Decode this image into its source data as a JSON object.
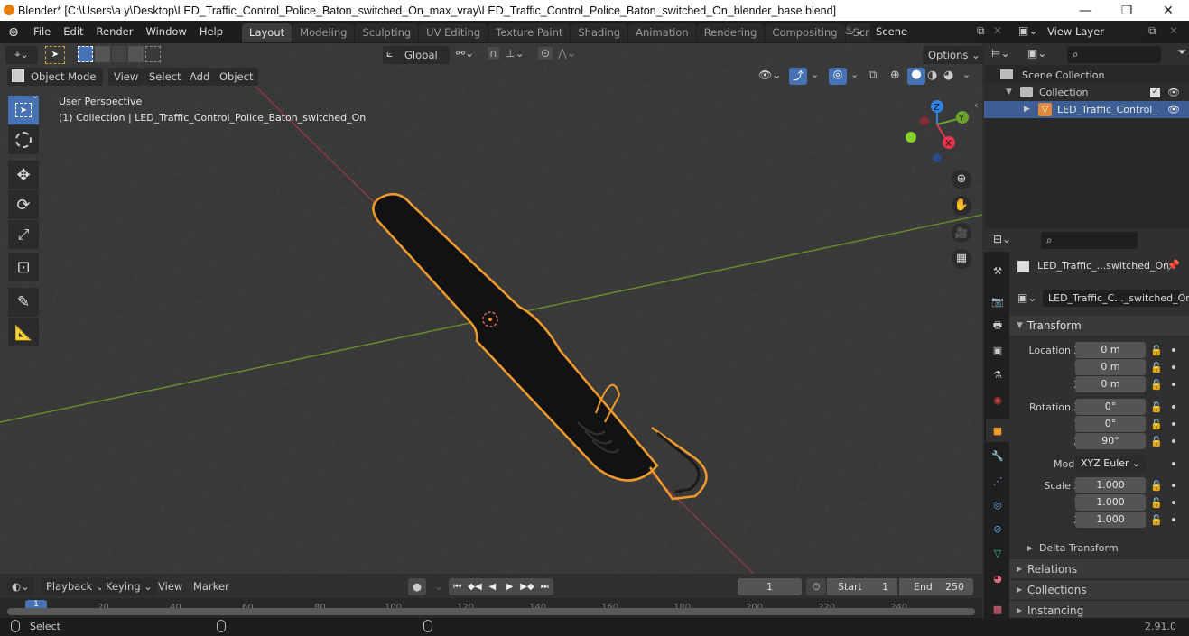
{
  "window": {
    "title": "Blender* [C:\\Users\\a y\\Desktop\\LED_Traffic_Control_Police_Baton_switched_On_max_vray\\LED_Traffic_Control_Police_Baton_switched_On_blender_base.blend]",
    "minimize": "—",
    "maximize": "❐",
    "close": "✕"
  },
  "menu": [
    "File",
    "Edit",
    "Render",
    "Window",
    "Help"
  ],
  "workspaces": [
    {
      "label": "Layout",
      "active": true
    },
    {
      "label": "Modeling"
    },
    {
      "label": "Sculpting"
    },
    {
      "label": "UV Editing"
    },
    {
      "label": "Texture Paint"
    },
    {
      "label": "Shading"
    },
    {
      "label": "Animation"
    },
    {
      "label": "Rendering"
    },
    {
      "label": "Compositing"
    },
    {
      "label": "Scripting"
    }
  ],
  "add_workspace": "+",
  "scene": {
    "value": "Scene"
  },
  "view_layer": {
    "value": "View Layer"
  },
  "toolbar": {
    "orientation": "Global",
    "options": "Options"
  },
  "header": {
    "mode": "Object Mode",
    "view": "View",
    "select": "Select",
    "add": "Add",
    "object": "Object"
  },
  "viewport": {
    "perspective": "User Perspective",
    "collection_info": "(1) Collection | LED_Traffic_Control_Police_Baton_switched_On",
    "gizmo": {
      "x": "X",
      "y": "Y",
      "z": "Z"
    },
    "colors": {
      "x": "#e8344a",
      "y": "#6ba32b",
      "z": "#2f84e8",
      "selection": "#f09a2a"
    }
  },
  "tools": [
    "select-box",
    "cursor",
    "move",
    "rotate",
    "scale",
    "transform",
    "annotate",
    "measure"
  ],
  "outliner": {
    "search_placeholder": "",
    "items": [
      {
        "label": "Scene Collection",
        "level": 0
      },
      {
        "label": "Collection",
        "level": 1
      },
      {
        "label": "LED_Traffic_Control_",
        "level": 2,
        "selected": true
      }
    ]
  },
  "properties": {
    "object_name": "LED_Traffic_...switched_On",
    "data_name": "LED_Traffic_C..._switched_On",
    "transform_label": "Transform",
    "location": {
      "label": "Location X",
      "x": "0 m",
      "y": "0 m",
      "z": "0 m"
    },
    "rotation": {
      "label": "Rotation X",
      "x": "0°",
      "y": "0°",
      "z": "90°"
    },
    "mode": {
      "label": "Mode",
      "value": "XYZ Euler"
    },
    "scale": {
      "label": "Scale X",
      "x": "1.000",
      "y": "1.000",
      "z": "1.000"
    },
    "axis_y": "Y",
    "axis_z": "Z",
    "sections": [
      "Delta Transform",
      "Relations",
      "Collections",
      "Instancing"
    ]
  },
  "timeline": {
    "playback": "Playback",
    "keying": "Keying",
    "view": "View",
    "marker": "Marker",
    "current_frame": "1",
    "start_label": "Start",
    "start": "1",
    "end_label": "End",
    "end": "250",
    "ticks": [
      "1",
      "20",
      "40",
      "60",
      "80",
      "100",
      "120",
      "140",
      "160",
      "180",
      "200",
      "220",
      "240"
    ]
  },
  "status": {
    "select": "Select",
    "version": "2.91.0"
  }
}
